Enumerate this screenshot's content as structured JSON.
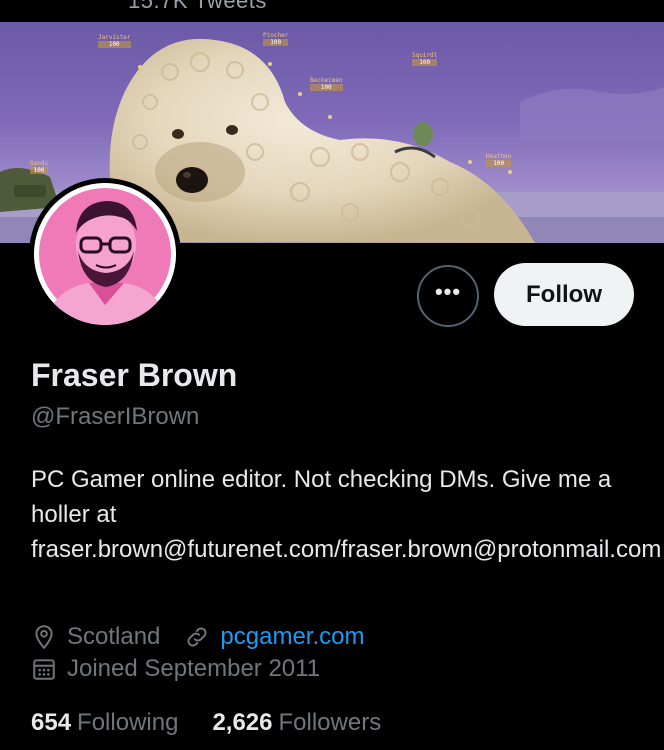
{
  "header": {
    "tweets_count": "15.7K Tweets"
  },
  "banner": {
    "worm_labels": [
      {
        "name": "Jarvister",
        "hp": "100"
      },
      {
        "name": "Pincher",
        "hp": "100"
      },
      {
        "name": "Beckeimen",
        "hp": "100"
      },
      {
        "name": "Squirdl",
        "hp": "100"
      },
      {
        "name": "Heathen",
        "hp": "100"
      },
      {
        "name": "Gands",
        "hp": "100"
      }
    ]
  },
  "profile": {
    "name": "Fraser Brown",
    "handle": "@FraserIBrown",
    "bio": "PC Gamer online editor. Not checking DMs. Give me a holler at fraser.brown@futurenet.com/fraser.brown@protonmail.com",
    "location": "Scotland",
    "website": "pcgamer.com",
    "joined": "Joined September 2011"
  },
  "actions": {
    "more_label": "•••",
    "follow_label": "Follow"
  },
  "stats": {
    "following_count": "654",
    "following_label": "Following",
    "followers_count": "2,626",
    "followers_label": "Followers"
  },
  "colors": {
    "link": "#1d9bf0",
    "muted": "#71767b",
    "follow_bg": "#eff3f4",
    "banner": "#7f6ab8"
  },
  "icons": {
    "location": "map-pin-icon",
    "link": "link-icon",
    "joined": "calendar-icon",
    "more": "more-icon"
  }
}
